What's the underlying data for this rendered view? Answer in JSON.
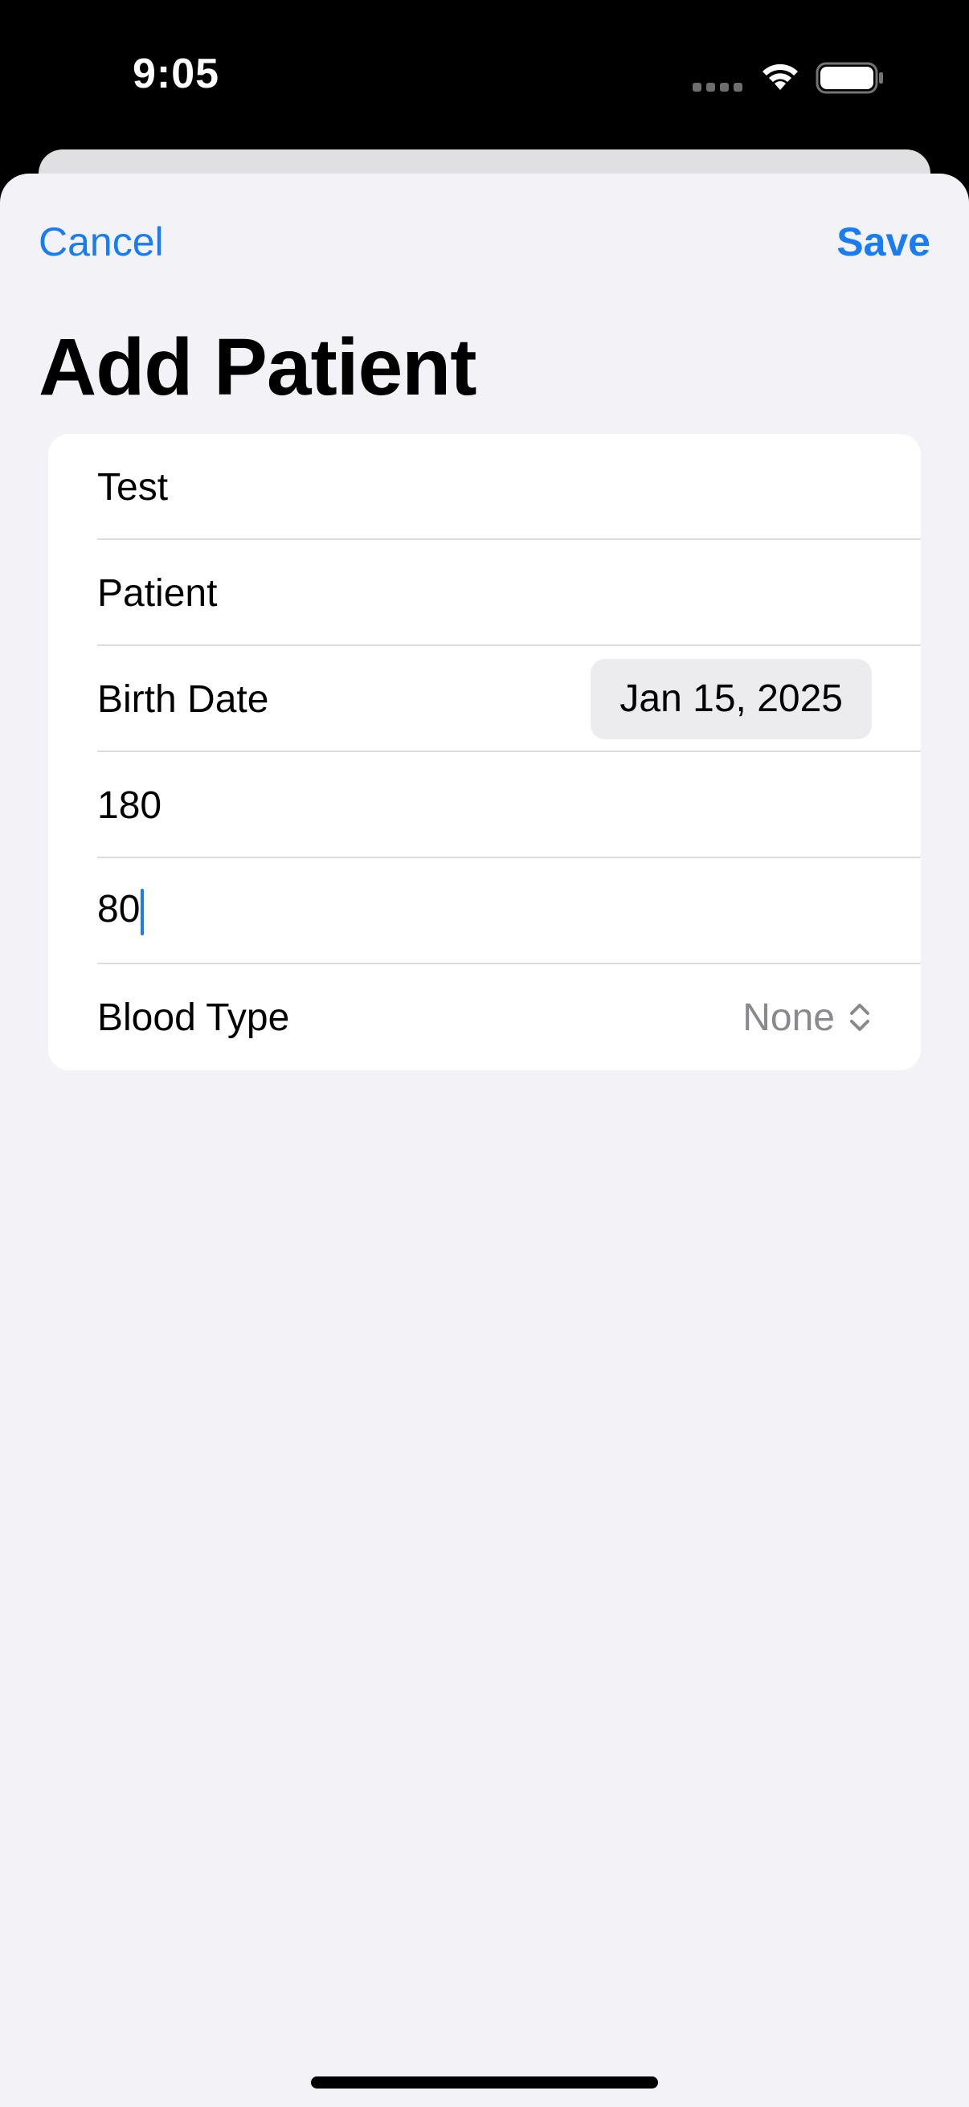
{
  "status_bar": {
    "time": "9:05",
    "icons": [
      "signal-dots-icon",
      "wifi-icon",
      "battery-icon"
    ]
  },
  "nav": {
    "cancel_label": "Cancel",
    "save_label": "Save"
  },
  "title": "Add Patient",
  "form": {
    "first_name_value": "Test",
    "last_name_value": "Patient",
    "birth_date_label": "Birth Date",
    "birth_date_value": "Jan 15, 2025",
    "height_value": "180",
    "weight_value": "80",
    "blood_type_label": "Blood Type",
    "blood_type_value": "None"
  },
  "colors": {
    "accent": "#1a7cf2",
    "background": "#f2f2f7",
    "card": "#ffffff",
    "secondary_text": "#8a8a8e"
  }
}
